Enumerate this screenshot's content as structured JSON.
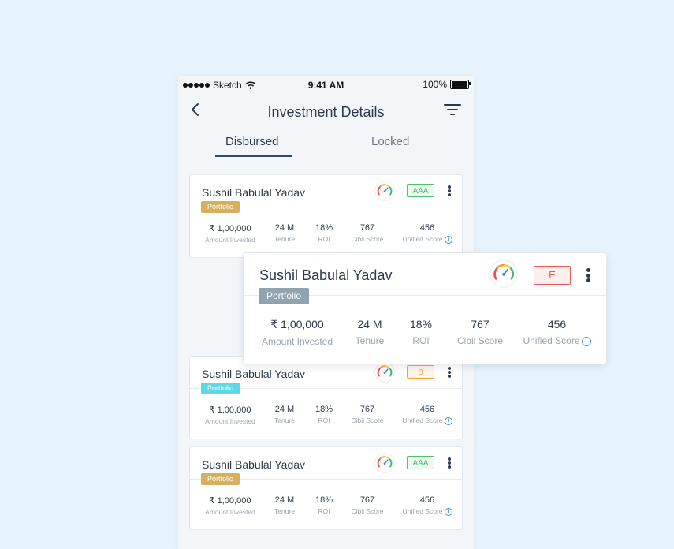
{
  "status_bar": {
    "carrier": "Sketch",
    "time": "9:41 AM",
    "battery": "100%"
  },
  "header": {
    "title": "Investment Details"
  },
  "tabs": [
    {
      "label": "Disbursed",
      "active": true
    },
    {
      "label": "Locked",
      "active": false
    }
  ],
  "stat_labels": {
    "amount": "Amount Invested",
    "tenure": "Tenure",
    "roi": "ROI",
    "cibil": "Cibil Score",
    "unified": "Unified Score"
  },
  "info_icon": "i",
  "colors": {
    "portfolio_gold": "#d7b05c",
    "portfolio_cyan": "#5ed7ea",
    "portfolio_grey": "#8fa3b0",
    "grade_green": "#4cc26b",
    "grade_orange": "#f2a43a",
    "grade_red": "#ec5a5a",
    "tab_underline": "#2d4a6a",
    "background": "#e8f4fd"
  },
  "cards": [
    {
      "name": "Sushil Babulal Yadav",
      "tag": "Portfolio",
      "grade": "AAA",
      "amount": "₹ 1,00,000",
      "tenure": "24 M",
      "roi": "18%",
      "cibil": "767",
      "unified": "456"
    },
    {
      "name": "Sushil Babulal Yadav",
      "tag": "Portfolio",
      "grade": "B",
      "amount": "₹ 1,00,000",
      "tenure": "24 M",
      "roi": "18%",
      "cibil": "767",
      "unified": "456"
    },
    {
      "name": "Sushil Babulal Yadav",
      "tag": "Portfolio",
      "grade": "AAA",
      "amount": "₹ 1,00,000",
      "tenure": "24 M",
      "roi": "18%",
      "cibil": "767",
      "unified": "456"
    }
  ],
  "featured_card": {
    "name": "Sushil Babulal Yadav",
    "tag": "Portfolio",
    "grade": "E",
    "amount": "₹ 1,00,000",
    "tenure": "24 M",
    "roi": "18%",
    "cibil": "767",
    "unified": "456"
  }
}
